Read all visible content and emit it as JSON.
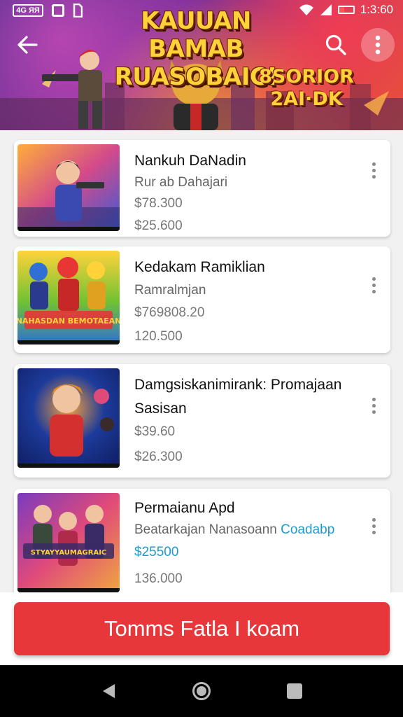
{
  "status_bar": {
    "time": "1:3:60",
    "left_icon_text": "4G ЯЯ",
    "icons": [
      "notification-icon",
      "sim-icon",
      "wifi-icon",
      "signal-icon",
      "battery-icon"
    ]
  },
  "header": {
    "title": "KAUUAN BAMAB RUASOBAIC!",
    "subtitle": "8SORIOR 2AI·DK",
    "back_icon": "arrow-left-icon",
    "search_icon": "search-icon",
    "more_icon": "more-vertical-icon"
  },
  "products": [
    {
      "title": "Nankuh DaNadin",
      "subtitle": "Rur ab Dahajari",
      "price_1": "$78.300",
      "price_2": "$25.600",
      "thumb_palette": [
        "#ffae3a",
        "#d34a8a",
        "#3a5bd6",
        "#2b2b6b"
      ]
    },
    {
      "title": "Kedakam Ramiklian",
      "subtitle": "Ramralmjan",
      "price_1": "$769808.20",
      "price_2": "120.500",
      "badge": "NAHASDAN BEMOTAEAN",
      "thumb_palette": [
        "#6fc232",
        "#e83535",
        "#2f6fd6",
        "#ffd23a"
      ]
    },
    {
      "title": "Damgsiskanimirank: Promajaan",
      "title_line_2": "Sasisan",
      "price_1": "$39.60",
      "price_2": "$26.300",
      "thumb_palette": [
        "#1d3b9b",
        "#d53030",
        "#f7a23b",
        "#11226a"
      ]
    },
    {
      "title": "Permaianu Apd",
      "subtitle": "Beatarkajan Nanasoann",
      "subtitle_accent": "Coadabp",
      "price_1": "$25500",
      "price_2": "136.000",
      "badge": "STYAYYAUMAGRAIC",
      "thumb_palette": [
        "#7a3bbf",
        "#e04a7a",
        "#f0a640",
        "#3a2a66"
      ]
    }
  ],
  "cta": {
    "label": "Tomms Fatla I koam"
  },
  "nav_bar": {
    "icons": [
      "back-triangle-icon",
      "home-circle-icon",
      "recents-square-icon"
    ]
  },
  "colors": {
    "accent_red": "#e8373a",
    "price_blue": "#1e9bd0",
    "title_yellow": "#ffd23a"
  }
}
